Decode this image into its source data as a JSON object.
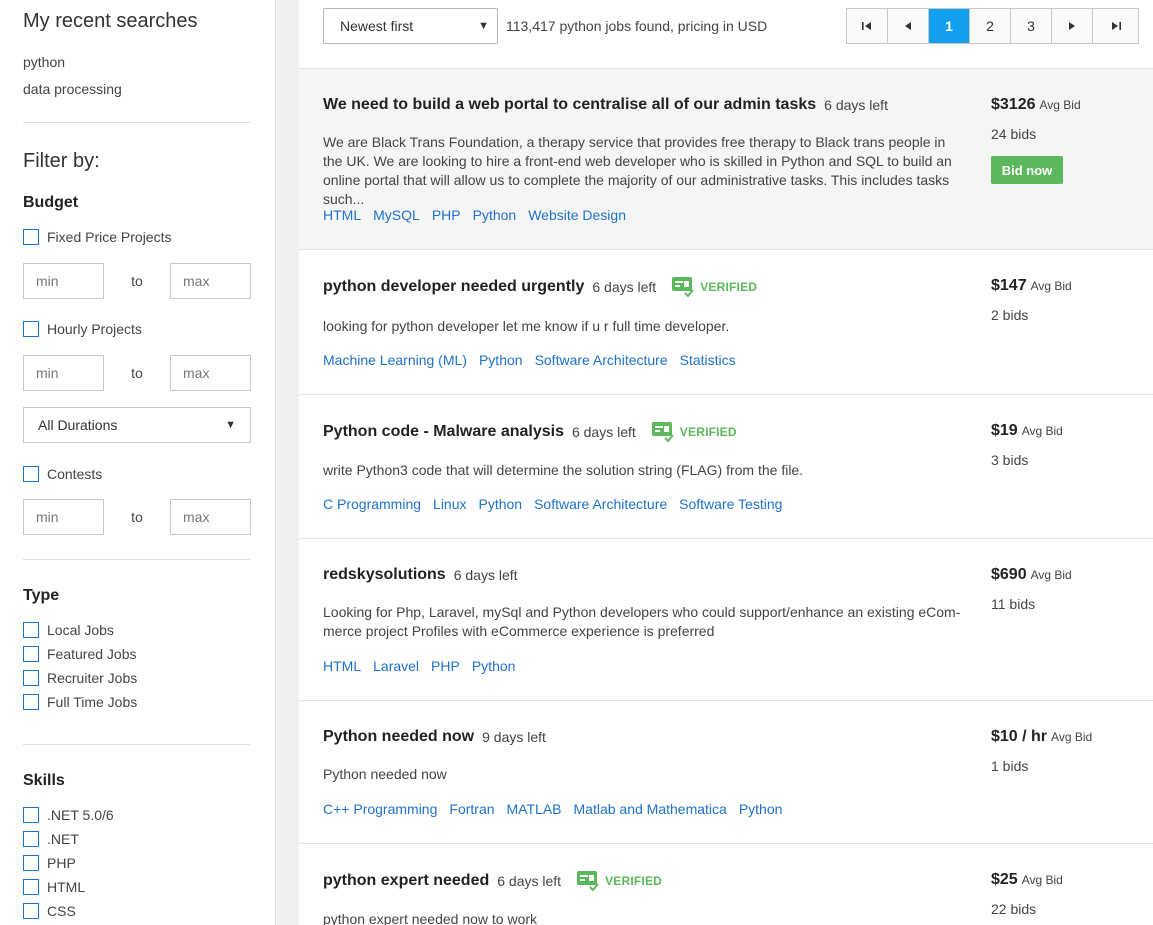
{
  "sidebar": {
    "recent_title": "My recent searches",
    "recent": [
      "python",
      "data processing"
    ],
    "filter_title": "Filter by:",
    "budget": {
      "heading": "Budget",
      "fixed_label": "Fixed Price Projects",
      "hourly_label": "Hourly Projects",
      "contests_label": "Contests",
      "min_placeholder": "min",
      "max_placeholder": "max",
      "to_label": "to",
      "duration_value": "All Durations"
    },
    "type": {
      "heading": "Type",
      "items": [
        "Local Jobs",
        "Featured Jobs",
        "Recruiter Jobs",
        "Full Time Jobs"
      ]
    },
    "skills": {
      "heading": "Skills",
      "items": [
        ".NET 5.0/6",
        ".NET",
        "PHP",
        "HTML",
        "CSS"
      ]
    }
  },
  "topbar": {
    "sort_value": "Newest first",
    "result_count": "113,417 python jobs found, pricing in USD",
    "pages": [
      "1",
      "2",
      "3"
    ],
    "active_page": "1"
  },
  "jobs": [
    {
      "title": "We need to build a web portal to centralise all of our admin tasks",
      "days": "6 days left",
      "verified": false,
      "desc": "We are Black Trans Foundation, a therapy service that provides free therapy to Black trans people in the UK. We are looking to hire a front-end web developer who is skilled in Python and SQL to build an online portal that will allow us to complete the majority of our administrative tasks. This includes tasks such...",
      "tags": [
        "HTML",
        "MySQL",
        "PHP",
        "Python",
        "Website Design"
      ],
      "price": "$3126",
      "bids": "24 bids",
      "bid_now": "Bid now"
    },
    {
      "title": "python developer needed urgently",
      "days": "6 days left",
      "verified": true,
      "desc": "looking for python developer let me know if u r full time developer.",
      "tags": [
        "Machine Learning (ML)",
        "Python",
        "Software Architecture",
        "Statistics"
      ],
      "price": "$147",
      "bids": "2 bids"
    },
    {
      "title": "Python code - Malware analysis",
      "days": "6 days left",
      "verified": true,
      "desc": "write Python3 code that will determine the solution string (FLAG) from the file.",
      "tags": [
        "C Programming",
        "Linux",
        "Python",
        "Software Architecture",
        "Software Testing"
      ],
      "price": "$19",
      "bids": "3 bids"
    },
    {
      "title": "redskysolutions",
      "days": "6 days left",
      "verified": false,
      "desc": "Looking for Php, Laravel, mySql and Python developers who could support/enhance an existing eCom-merce project Profiles with eCommerce experience is preferred",
      "tags": [
        "HTML",
        "Laravel",
        "PHP",
        "Python"
      ],
      "price": "$690",
      "bids": "11 bids"
    },
    {
      "title": "Python needed now",
      "days": "9 days left",
      "verified": false,
      "desc": "Python needed now",
      "tags": [
        "C++ Programming",
        "Fortran",
        "MATLAB",
        "Matlab and Mathematica",
        "Python"
      ],
      "price": "$10 / hr",
      "bids": "1 bids"
    },
    {
      "title": "python expert needed",
      "days": "6 days left",
      "verified": true,
      "desc": "python expert needed now to work",
      "tags": [],
      "price": "$25",
      "bids": "22 bids"
    }
  ],
  "labels": {
    "verified": "VERIFIED",
    "avg_bid": "Avg Bid"
  },
  "colors": {
    "accent": "#139ff0",
    "link": "#1f72c9",
    "verified": "#5cb85c",
    "bid_button": "#5cb85c"
  }
}
